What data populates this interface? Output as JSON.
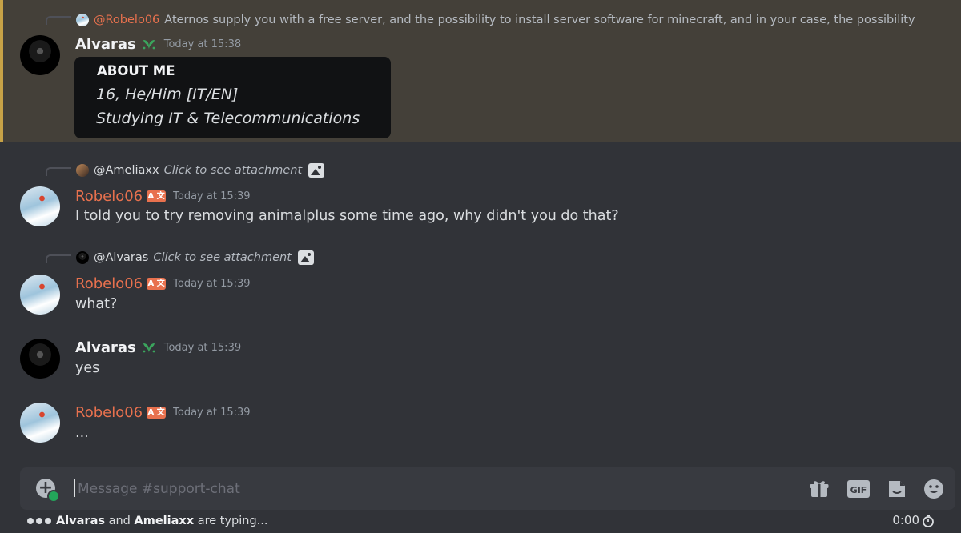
{
  "mention_message": {
    "reply_name": "@Robelo06",
    "reply_text": "Aternos supply you with a free server, and the possibility to install server software for minecraft, and in your case, the possibility",
    "author": "Alvaras",
    "timestamp": "Today at 15:38",
    "card": {
      "title": "ABOUT ME",
      "line1": "16, He/Him [IT/EN]",
      "line2": "Studying IT & Telecommunications"
    }
  },
  "messages": [
    {
      "reply_name": "@Ameliaxx",
      "reply_text": "Click to see attachment",
      "author": "Robelo06",
      "badge": "A 文",
      "timestamp": "Today at 15:39",
      "text": "I told you to try removing animalplus some time ago, why didn't you do that?"
    },
    {
      "reply_name": "@Alvaras",
      "reply_text": "Click to see attachment",
      "author": "Robelo06",
      "badge": "A 文",
      "timestamp": "Today at 15:39",
      "text": "what?"
    },
    {
      "author": "Alvaras",
      "timestamp": "Today at 15:39",
      "text": "yes"
    },
    {
      "author": "Robelo06",
      "badge": "A 文",
      "timestamp": "Today at 15:39",
      "text": "..."
    }
  ],
  "composer": {
    "placeholder": "Message #support-chat",
    "gif_label": "GIF"
  },
  "typing": {
    "user1": "Alvaras",
    "and": "and",
    "user2": "Ameliaxx",
    "suffix": "are typing..."
  },
  "timer": "0:00",
  "icons": [
    "image-icon",
    "gift-icon",
    "gif-icon",
    "sticker-icon",
    "emoji-icon",
    "add-icon",
    "timer-icon",
    "leaf-icon"
  ],
  "colors": {
    "background": "#313338",
    "mention_highlight": "#444039",
    "mention_bar": "#c7a247",
    "robelo_name": "#e8714e",
    "composer": "#383a40"
  }
}
